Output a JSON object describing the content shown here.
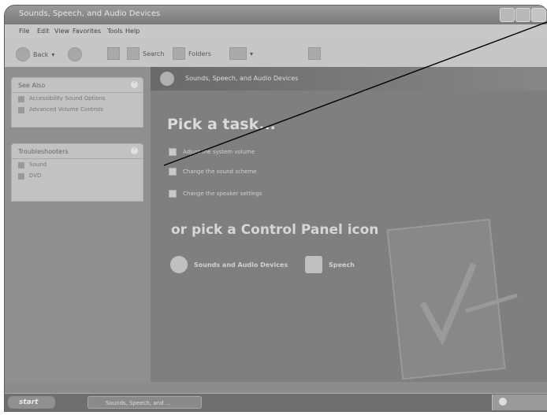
{
  "window": {
    "title": "Sounds, Speech, and Audio Devices"
  },
  "menu": [
    "File",
    "Edit",
    "View",
    "Favorites",
    "Tools",
    "Help"
  ],
  "toolbar": {
    "back": "Back",
    "search": "Search",
    "folders": "Folders"
  },
  "see_also": {
    "title": "See Also",
    "items": [
      "Accessibility Sound Options",
      "Advanced Volume Controls"
    ]
  },
  "troubleshooters": {
    "title": "Troubleshooters",
    "items": [
      "Sound",
      "DVD"
    ]
  },
  "banner": {
    "title": "Sounds, Speech, and Audio Devices"
  },
  "pick_task": {
    "heading": "Pick a task...",
    "tasks": [
      "Adjust the system volume",
      "Change the sound scheme",
      "Change the speaker settings"
    ]
  },
  "control_panel": {
    "heading": "or pick a Control Panel icon",
    "icons": [
      "Sounds and Audio Devices",
      "Speech"
    ]
  },
  "taskbar": {
    "start": "start",
    "task_button": "Sounds, Speech, and ..."
  }
}
